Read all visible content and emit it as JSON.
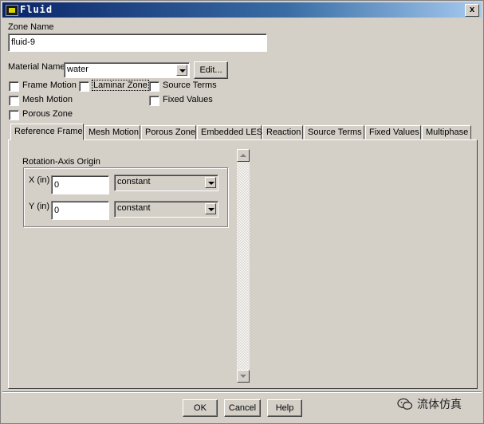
{
  "window": {
    "title": "Fluid",
    "close_glyph": "x"
  },
  "zone": {
    "label": "Zone Name",
    "value": "fluid-9"
  },
  "material": {
    "label": "Material Name",
    "value": "water",
    "edit_label": "Edit..."
  },
  "options": {
    "frame_motion": "Frame Motion",
    "laminar_zone": "Laminar Zone",
    "source_terms": "Source Terms",
    "mesh_motion": "Mesh Motion",
    "fixed_values": "Fixed Values",
    "porous_zone": "Porous Zone"
  },
  "tabs": [
    {
      "label": "Reference Frame",
      "active": true
    },
    {
      "label": "Mesh Motion"
    },
    {
      "label": "Porous Zone"
    },
    {
      "label": "Embedded LES"
    },
    {
      "label": "Reaction"
    },
    {
      "label": "Source Terms"
    },
    {
      "label": "Fixed Values"
    },
    {
      "label": "Multiphase"
    }
  ],
  "rotation": {
    "group_label": "Rotation-Axis Origin",
    "x_label": "X (in)",
    "x_value": "0",
    "x_method": "constant",
    "y_label": "Y (in)",
    "y_value": "0",
    "y_method": "constant"
  },
  "buttons": {
    "ok": "OK",
    "cancel": "Cancel",
    "help": "Help"
  },
  "watermark": {
    "text": "流体仿真",
    "icon": "wechat-icon"
  },
  "colors": {
    "titlebar_start": "#0a246a",
    "titlebar_end": "#a6caf0",
    "dialog_bg": "#d4d0c8"
  }
}
